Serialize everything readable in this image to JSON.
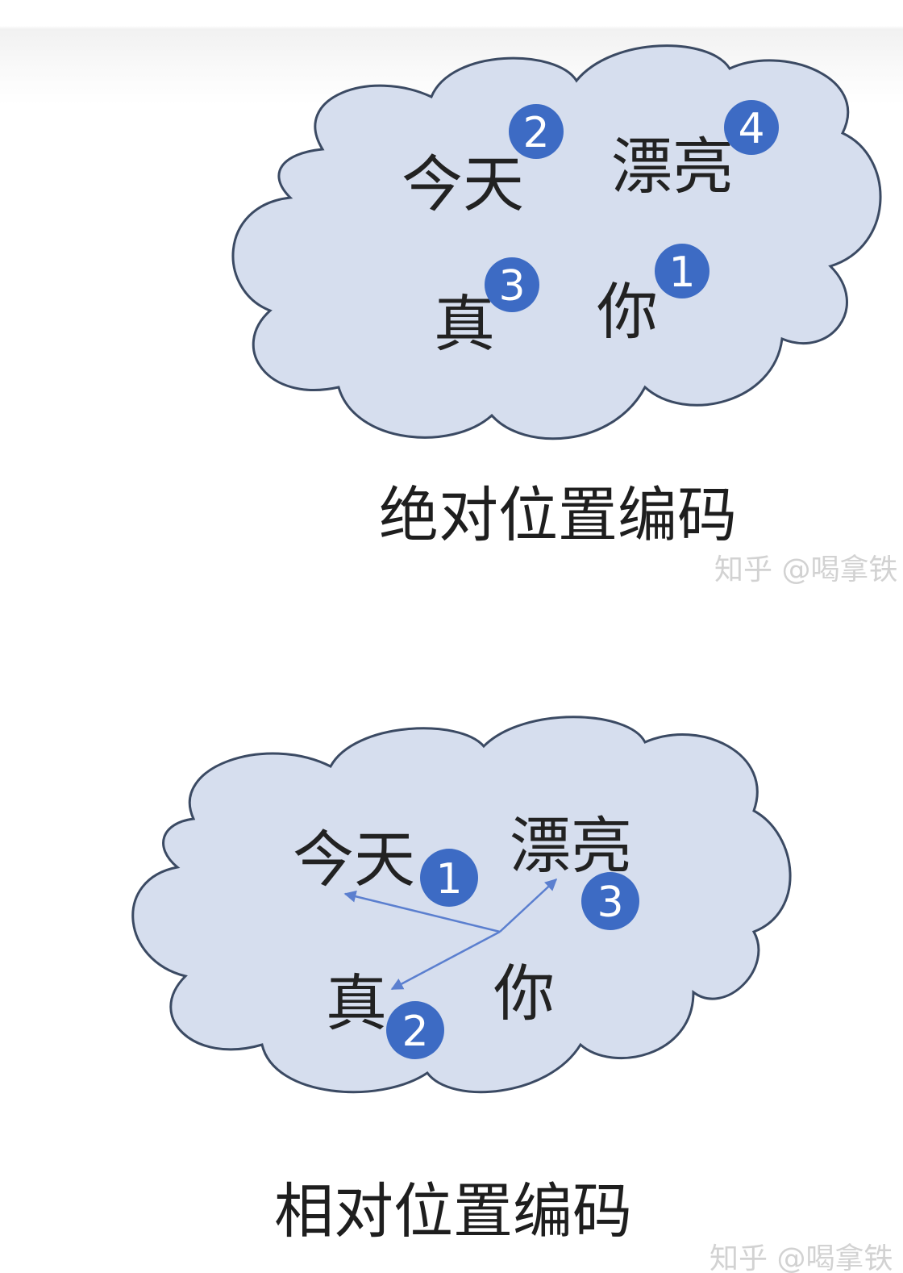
{
  "diagrams": [
    {
      "caption": "绝对位置编码",
      "words": [
        {
          "text": "今天",
          "badge": "2"
        },
        {
          "text": "漂亮",
          "badge": "4"
        },
        {
          "text": "真",
          "badge": "3"
        },
        {
          "text": "你",
          "badge": "1"
        }
      ],
      "watermark": "知乎 @喝拿铁"
    },
    {
      "caption": "相对位置编码",
      "words": [
        {
          "text": "今天",
          "badge": "1"
        },
        {
          "text": "漂亮",
          "badge": "3"
        },
        {
          "text": "真",
          "badge": "2"
        },
        {
          "text": "你",
          "badge": ""
        }
      ],
      "watermark": "知乎 @喝拿铁"
    }
  ],
  "colors": {
    "cloud_fill": "#d6deee",
    "cloud_stroke": "#3b4a63",
    "badge": "#3d6bc4",
    "arrow": "#5b7fcf"
  }
}
